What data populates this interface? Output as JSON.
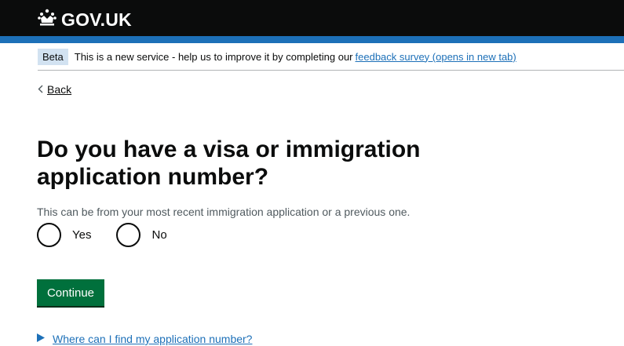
{
  "header": {
    "logo_text": "GOV.UK",
    "crown_icon": "crown-icon",
    "background": "#0b0c0c",
    "accent_bar": "#1d70b8"
  },
  "beta_banner": {
    "tag": "Beta",
    "text": "This is a new service - help us to improve it by completing our",
    "link": "feedback survey (opens in new tab)"
  },
  "nav": {
    "back_label": "Back",
    "back_icon": "chevron-left-icon"
  },
  "question": {
    "heading": "Do you have a visa or immigration application number?",
    "hint": "This can be from your most recent immigration application or a previous one.",
    "options": [
      {
        "label": "Yes",
        "selected": false
      },
      {
        "label": "No",
        "selected": false
      }
    ]
  },
  "actions": {
    "continue_label": "Continue",
    "button_color": "#00703c"
  },
  "details": {
    "summary": "Where can I find my application number?",
    "toggle_icon": "triangle-right-icon"
  }
}
